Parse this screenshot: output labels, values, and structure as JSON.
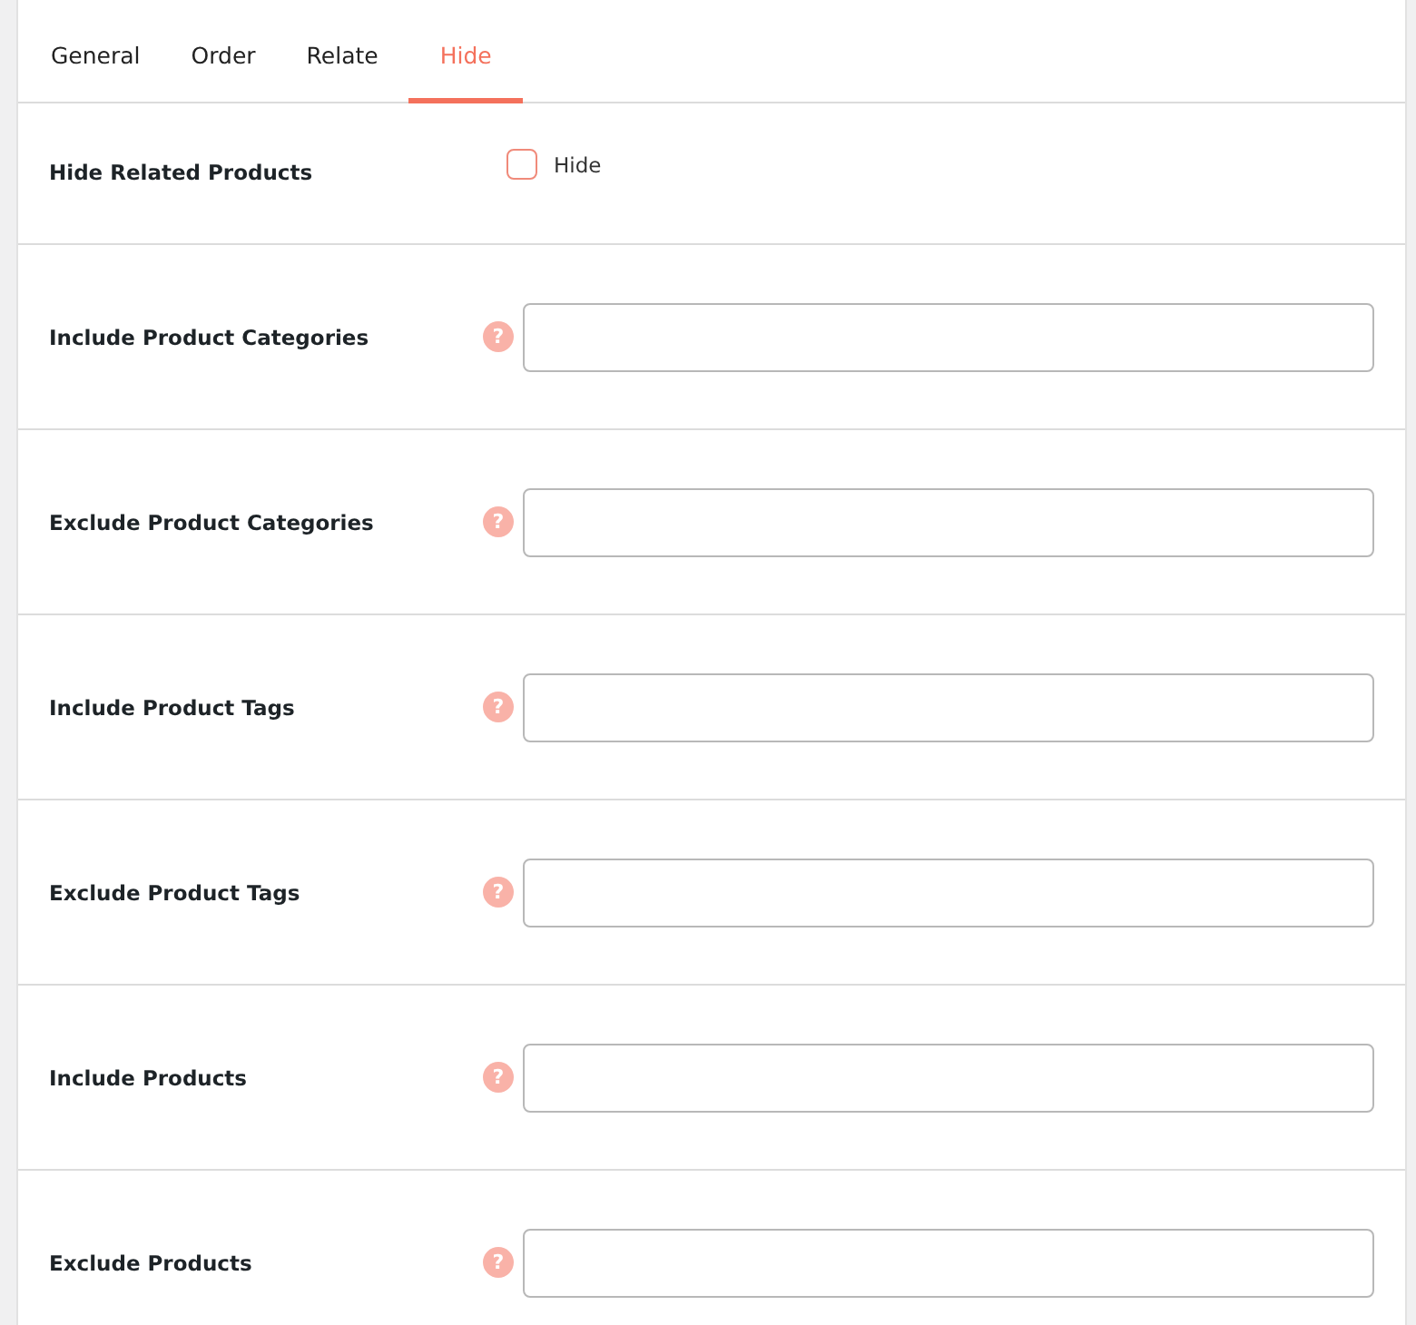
{
  "tabs": [
    {
      "label": "General",
      "selected": false
    },
    {
      "label": "Order",
      "selected": false
    },
    {
      "label": "Relate",
      "selected": false
    },
    {
      "label": "Hide",
      "selected": true
    }
  ],
  "rows": [
    {
      "kind": "checkbox",
      "label": "Hide Related Products",
      "option": "Hide",
      "checked": false
    },
    {
      "kind": "field",
      "label": "Include Product Categories",
      "help": "?"
    },
    {
      "kind": "field",
      "label": "Exclude Product Categories",
      "help": "?"
    },
    {
      "kind": "field",
      "label": "Include Product Tags",
      "help": "?"
    },
    {
      "kind": "field",
      "label": "Exclude Product Tags",
      "help": "?"
    },
    {
      "kind": "field",
      "label": "Include Products",
      "help": "?"
    },
    {
      "kind": "field",
      "label": "Exclude Products",
      "help": "?"
    }
  ]
}
